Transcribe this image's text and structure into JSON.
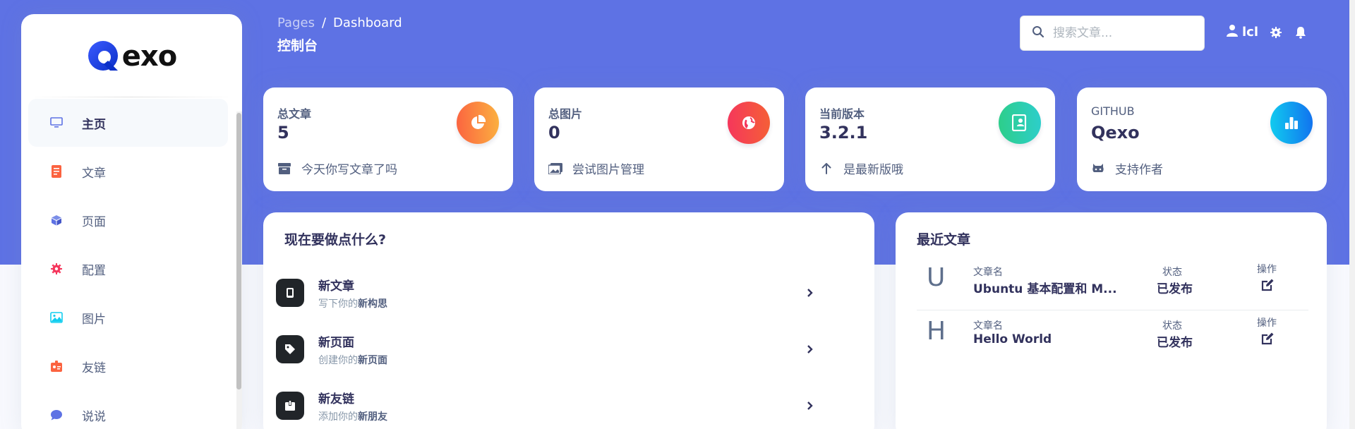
{
  "colors": {
    "hero": "#5e72e4",
    "accent_orange": "#fb6340",
    "accent_red": "#f5365c",
    "accent_green": "#2dce89",
    "accent_blue": "#11cdef"
  },
  "brand": {
    "text": "exo",
    "icon": "qexo-logo-q"
  },
  "sidebar": {
    "items": [
      {
        "label": "主页",
        "icon": "monitor-icon",
        "active": true
      },
      {
        "label": "文章",
        "icon": "document-icon"
      },
      {
        "label": "页面",
        "icon": "cube-icon"
      },
      {
        "label": "配置",
        "icon": "gear-icon"
      },
      {
        "label": "图片",
        "icon": "image-icon"
      },
      {
        "label": "友链",
        "icon": "badge-icon"
      },
      {
        "label": "说说",
        "icon": "chat-icon"
      }
    ]
  },
  "header": {
    "breadcrumb_root": "Pages",
    "breadcrumb_sep": "/",
    "breadcrumb_current": "Dashboard",
    "title": "控制台",
    "search_placeholder": "搜索文章...",
    "user": "lcl"
  },
  "stats": [
    {
      "title": "总文章",
      "value": "5",
      "footer": "今天你写文章了吗",
      "badge_icon": "pie-chart-icon",
      "footer_icon": "archive-icon"
    },
    {
      "title": "总图片",
      "value": "0",
      "footer": "尝试图片管理",
      "badge_icon": "globe-icon",
      "footer_icon": "images-icon"
    },
    {
      "title": "当前版本",
      "value": "3.2.1",
      "footer": "是最新版哦",
      "badge_icon": "id-card-icon",
      "footer_icon": "arrow-up-icon"
    },
    {
      "title": "GITHUB",
      "value": "Qexo",
      "footer": "支持作者",
      "badge_icon": "bar-chart-icon",
      "footer_icon": "github-icon"
    }
  ],
  "actions_card": {
    "title": "现在要做点什么?",
    "items": [
      {
        "title": "新文章",
        "sub_prefix": "写下你的",
        "sub_bold": "新构思",
        "icon": "mobile-icon"
      },
      {
        "title": "新页面",
        "sub_prefix": "创建你的",
        "sub_bold": "新页面",
        "icon": "tag-icon"
      },
      {
        "title": "新友链",
        "sub_prefix": "添加你的",
        "sub_bold": "新朋友",
        "icon": "box-icon"
      }
    ]
  },
  "recent_card": {
    "title": "最近文章",
    "col_name": "文章名",
    "col_status": "状态",
    "col_action": "操作",
    "posts": [
      {
        "letter": "U",
        "name": "Ubuntu 基本配置和 M...",
        "status": "已发布"
      },
      {
        "letter": "H",
        "name": "Hello World",
        "status": "已发布"
      }
    ]
  }
}
